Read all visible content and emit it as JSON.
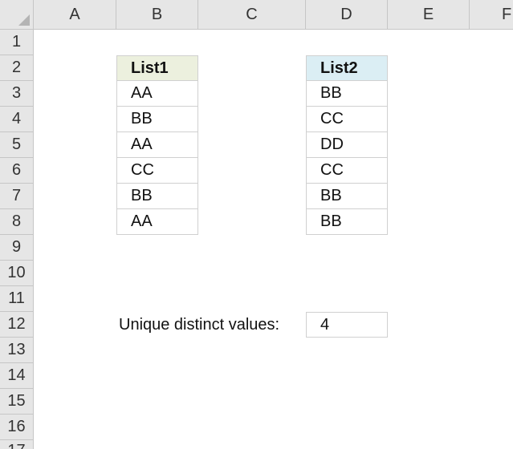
{
  "columns": [
    "A",
    "B",
    "C",
    "D",
    "E",
    "F"
  ],
  "rows": [
    "1",
    "2",
    "3",
    "4",
    "5",
    "6",
    "7",
    "8",
    "9",
    "10",
    "11",
    "12",
    "13",
    "14",
    "15",
    "16",
    "17"
  ],
  "list1": {
    "header": "List1",
    "values": [
      "AA",
      "BB",
      "AA",
      "CC",
      "BB",
      "AA"
    ]
  },
  "list2": {
    "header": "List2",
    "values": [
      "BB",
      "CC",
      "DD",
      "CC",
      "BB",
      "BB"
    ]
  },
  "result": {
    "label": "Unique distinct values:",
    "value": "4"
  },
  "colors": {
    "list1_header_bg": "#ecf0de",
    "list2_header_bg": "#dbeef4",
    "header_bg": "#e6e6e6"
  }
}
